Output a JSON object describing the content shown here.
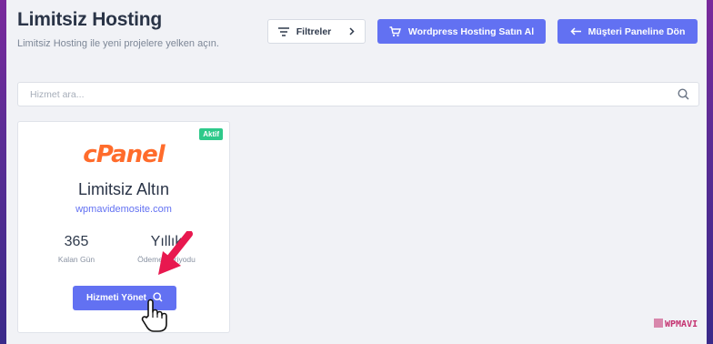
{
  "header": {
    "title": "Limitsiz Hosting",
    "subtitle": "Limitsiz Hosting ile yeni projelere yelken açın."
  },
  "toolbar": {
    "filter_label": "Filtreler",
    "wordpress_label": "Wordpress Hosting Satın Al",
    "panel_label": "Müşteri Paneline Dön"
  },
  "search": {
    "placeholder": "Hizmet ara..."
  },
  "service_card": {
    "status": "Aktif",
    "logo_text": "cPanel",
    "plan_name": "Limitsiz Altın",
    "domain": "wpmavidemosite.com",
    "days_value": "365",
    "days_label": "Kalan Gün",
    "period_value": "Yıllık",
    "period_label": "Ödeme Periyodu",
    "manage_label": "Hizmeti Yönet"
  },
  "watermark": {
    "text": "WPMAVI"
  },
  "colors": {
    "accent": "#6271f2",
    "status_green": "#2ec98a",
    "cpanel_orange": "#ff6c2c",
    "annotation_red": "#e8184f"
  }
}
